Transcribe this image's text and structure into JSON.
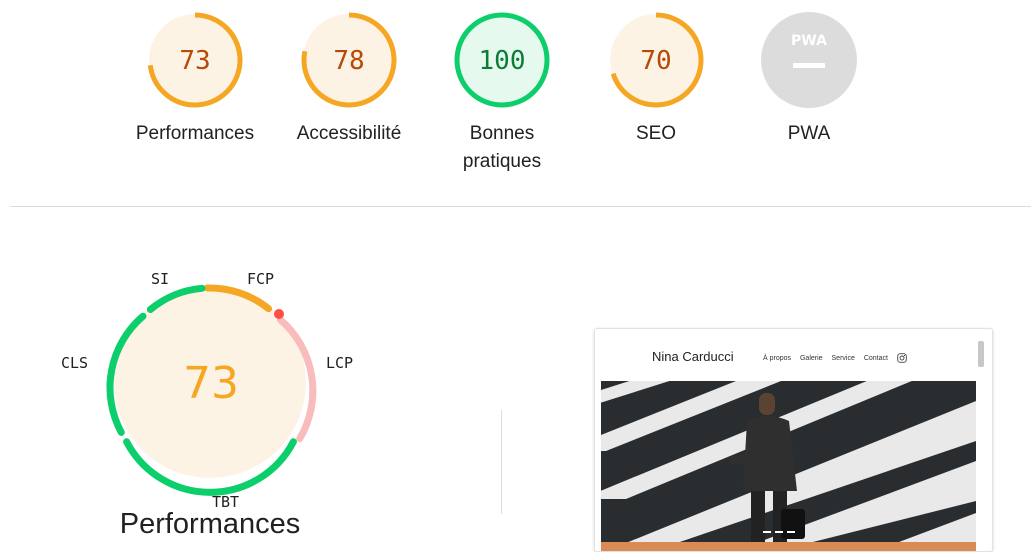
{
  "scores": [
    {
      "id": "performance",
      "value": "73",
      "label": "Performances",
      "fraction": 0.73,
      "color": "#f5a623",
      "text_color": "#b74a06",
      "bg": "#fdf3e5"
    },
    {
      "id": "accessibility",
      "value": "78",
      "label": "Accessibilité",
      "fraction": 0.78,
      "color": "#f5a623",
      "text_color": "#b74a06",
      "bg": "#fdf3e5"
    },
    {
      "id": "best-practices",
      "value": "100",
      "label": "Bonnes pratiques",
      "fraction": 1.0,
      "color": "#0cce6b",
      "text_color": "#0a7d36",
      "bg": "#e6f9ee"
    },
    {
      "id": "seo",
      "value": "70",
      "label": "SEO",
      "fraction": 0.7,
      "color": "#f5a623",
      "text_color": "#b74a06",
      "bg": "#fdf3e5"
    },
    {
      "id": "pwa",
      "value": "PWA",
      "label": "PWA",
      "color": "#cfcfcf",
      "text_color": "#ffffff",
      "bg": "#dcdcdc"
    }
  ],
  "performance_detail": {
    "score": "73",
    "title": "Performances",
    "metrics": {
      "si": "SI",
      "fcp": "FCP",
      "lcp": "LCP",
      "tbt": "TBT",
      "cls": "CLS"
    }
  },
  "preview": {
    "site_name": "Nina Carducci",
    "nav": [
      "À propos",
      "Galerie",
      "Service",
      "Contact"
    ],
    "instagram_icon": "instagram-icon"
  }
}
